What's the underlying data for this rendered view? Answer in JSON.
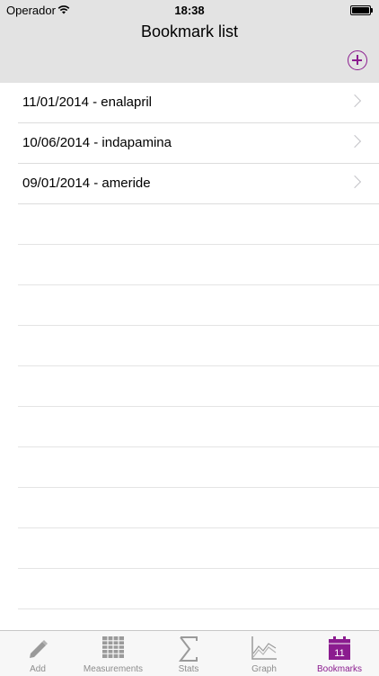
{
  "status_bar": {
    "carrier": "Operador",
    "time": "18:38"
  },
  "nav": {
    "title": "Bookmark list"
  },
  "bookmarks": [
    {
      "label": "11/01/2014 - enalapril"
    },
    {
      "label": "10/06/2014 - indapamina"
    },
    {
      "label": "09/01/2014 - ameride"
    }
  ],
  "tabs": [
    {
      "label": "Add",
      "icon": "pencil-icon"
    },
    {
      "label": "Measurements",
      "icon": "grid-icon"
    },
    {
      "label": "Stats",
      "icon": "sigma-icon"
    },
    {
      "label": "Graph",
      "icon": "graph-icon"
    },
    {
      "label": "Bookmarks",
      "icon": "calendar-icon",
      "badge": "11",
      "active": true
    }
  ],
  "colors": {
    "accent": "#8b1c8f",
    "header_bg": "#e3e3e3",
    "inactive_tab": "#8d8d8d"
  }
}
